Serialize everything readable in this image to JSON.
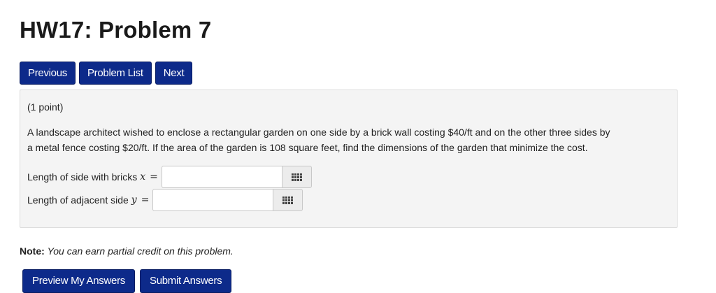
{
  "page": {
    "title": "HW17: Problem 7"
  },
  "nav": {
    "previous": "Previous",
    "problem_list": "Problem List",
    "next": "Next"
  },
  "problem": {
    "points": "(1 point)",
    "text_line1": "A landscape architect wished to enclose a rectangular garden on one side by a brick wall costing $40/ft and on the other three sides by",
    "text_line2": "a metal fence costing $20/ft. If the area of the garden is 108 square feet, find the dimensions of the garden that minimize the cost.",
    "answers": [
      {
        "label": "Length of side with bricks",
        "var": "x",
        "eq": "=",
        "value": ""
      },
      {
        "label": "Length of adjacent side",
        "var": "y",
        "eq": "=",
        "value": ""
      }
    ],
    "equation_editor_icon": "grid-icon"
  },
  "note": {
    "label": "Note:",
    "text": "You can earn partial credit on this problem."
  },
  "actions": {
    "preview": "Preview My Answers",
    "submit": "Submit Answers"
  },
  "colors": {
    "button_bg": "#0d2a8a",
    "panel_bg": "#f4f4f4"
  }
}
